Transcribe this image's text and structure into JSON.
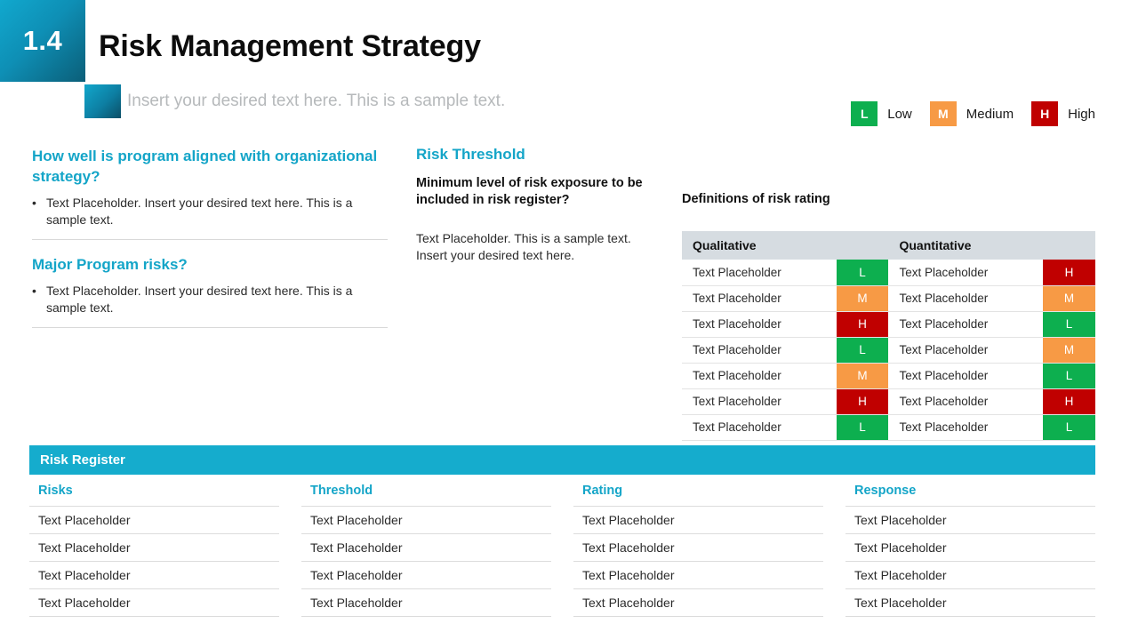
{
  "header": {
    "number": "1.4",
    "title": "Risk Management Strategy",
    "subtitle": "Insert your desired text here. This is a sample text."
  },
  "legend": {
    "items": [
      {
        "code": "L",
        "label": "Low",
        "color": "#0DAF4F"
      },
      {
        "code": "M",
        "label": "Medium",
        "color": "#F79A45"
      },
      {
        "code": "H",
        "label": "High",
        "color": "#C00000"
      }
    ]
  },
  "left_column": {
    "block1": {
      "heading": "How well is program aligned with organizational strategy?",
      "bullet_marker": "•",
      "bullet": "Text Placeholder. Insert your desired text here. This is a sample text."
    },
    "block2": {
      "heading": "Major Program risks?",
      "bullet_marker": "•",
      "bullet": "Text Placeholder. Insert your desired text here. This is a sample text."
    }
  },
  "middle_column": {
    "heading": "Risk Threshold",
    "subheading": "Minimum level of risk exposure to be included in risk register?",
    "body": "Text Placeholder. This is a sample text. Insert your desired text here."
  },
  "definitions": {
    "title": "Definitions of risk rating",
    "columns": [
      "Qualitative",
      "Quantitative"
    ],
    "rows": [
      {
        "qual_text": "Text Placeholder",
        "qual_rating": "L",
        "quant_text": "Text Placeholder",
        "quant_rating": "H"
      },
      {
        "qual_text": "Text Placeholder",
        "qual_rating": "M",
        "quant_text": "Text Placeholder",
        "quant_rating": "M"
      },
      {
        "qual_text": "Text Placeholder",
        "qual_rating": "H",
        "quant_text": "Text Placeholder",
        "quant_rating": "L"
      },
      {
        "qual_text": "Text Placeholder",
        "qual_rating": "L",
        "quant_text": "Text Placeholder",
        "quant_rating": "M"
      },
      {
        "qual_text": "Text Placeholder",
        "qual_rating": "M",
        "quant_text": "Text Placeholder",
        "quant_rating": "L"
      },
      {
        "qual_text": "Text Placeholder",
        "qual_rating": "H",
        "quant_text": "Text Placeholder",
        "quant_rating": "H"
      },
      {
        "qual_text": "Text Placeholder",
        "qual_rating": "L",
        "quant_text": "Text Placeholder",
        "quant_rating": "L"
      }
    ]
  },
  "risk_register": {
    "bar_label": "Risk Register",
    "columns": [
      {
        "heading": "Risks",
        "cells": [
          "Text Placeholder",
          "Text Placeholder",
          "Text Placeholder",
          "Text Placeholder"
        ]
      },
      {
        "heading": "Threshold",
        "cells": [
          "Text Placeholder",
          "Text Placeholder",
          "Text Placeholder",
          "Text Placeholder"
        ]
      },
      {
        "heading": "Rating",
        "cells": [
          "Text Placeholder",
          "Text Placeholder",
          "Text Placeholder",
          "Text Placeholder"
        ]
      },
      {
        "heading": "Response",
        "cells": [
          "Text Placeholder",
          "Text Placeholder",
          "Text Placeholder",
          "Text Placeholder"
        ]
      }
    ]
  },
  "colors": {
    "accent_cyan": "#14A5C8",
    "bar_cyan": "#15ACCD",
    "low": "#0DAF4F",
    "medium": "#F79A45",
    "high": "#C00000",
    "table_header_bg": "#D6DCE1"
  }
}
